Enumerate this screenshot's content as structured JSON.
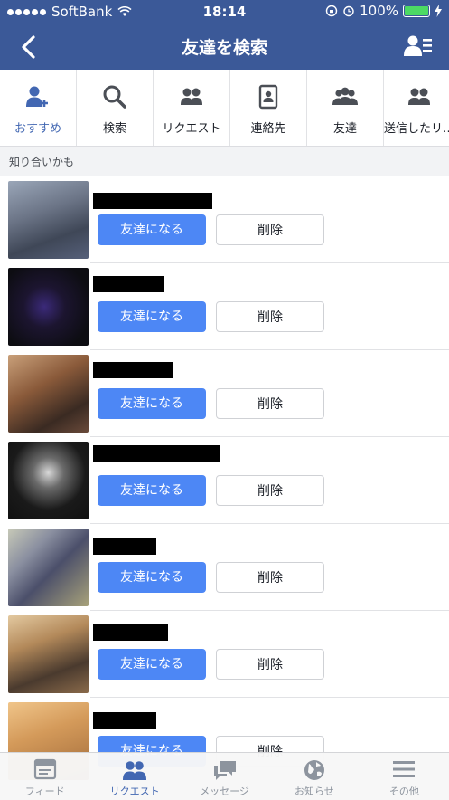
{
  "status_bar": {
    "carrier": "SoftBank",
    "time": "18:14",
    "battery": "100%"
  },
  "nav": {
    "title": "友達を検索"
  },
  "tabs": [
    {
      "label": "おすすめ",
      "icon": "add-friend-icon",
      "active": true
    },
    {
      "label": "検索",
      "icon": "search-icon"
    },
    {
      "label": "リクエスト",
      "icon": "friends-icon"
    },
    {
      "label": "連絡先",
      "icon": "contacts-icon"
    },
    {
      "label": "友達",
      "icon": "group-icon"
    },
    {
      "label": "送信したリ…",
      "icon": "friends-icon"
    }
  ],
  "section_title": "知り合いかも",
  "suggestions": [
    {
      "add_label": "友達になる",
      "delete_label": "削除"
    },
    {
      "add_label": "友達になる",
      "delete_label": "削除"
    },
    {
      "add_label": "友達になる",
      "delete_label": "削除"
    },
    {
      "add_label": "友達になる",
      "delete_label": "削除"
    },
    {
      "add_label": "友達になる",
      "delete_label": "削除"
    },
    {
      "add_label": "友達になる",
      "delete_label": "削除"
    },
    {
      "add_label": "友達になる",
      "delete_label": "削除"
    }
  ],
  "bottom_bar": [
    {
      "label": "フィード",
      "icon": "feed-icon"
    },
    {
      "label": "リクエスト",
      "icon": "friends-icon",
      "active": true
    },
    {
      "label": "メッセージ",
      "icon": "messages-icon"
    },
    {
      "label": "お知らせ",
      "icon": "globe-icon"
    },
    {
      "label": "その他",
      "icon": "menu-icon"
    }
  ],
  "colors": {
    "brand": "#3b5998",
    "accent": "#4267b2",
    "add_button": "#4d87f5"
  }
}
